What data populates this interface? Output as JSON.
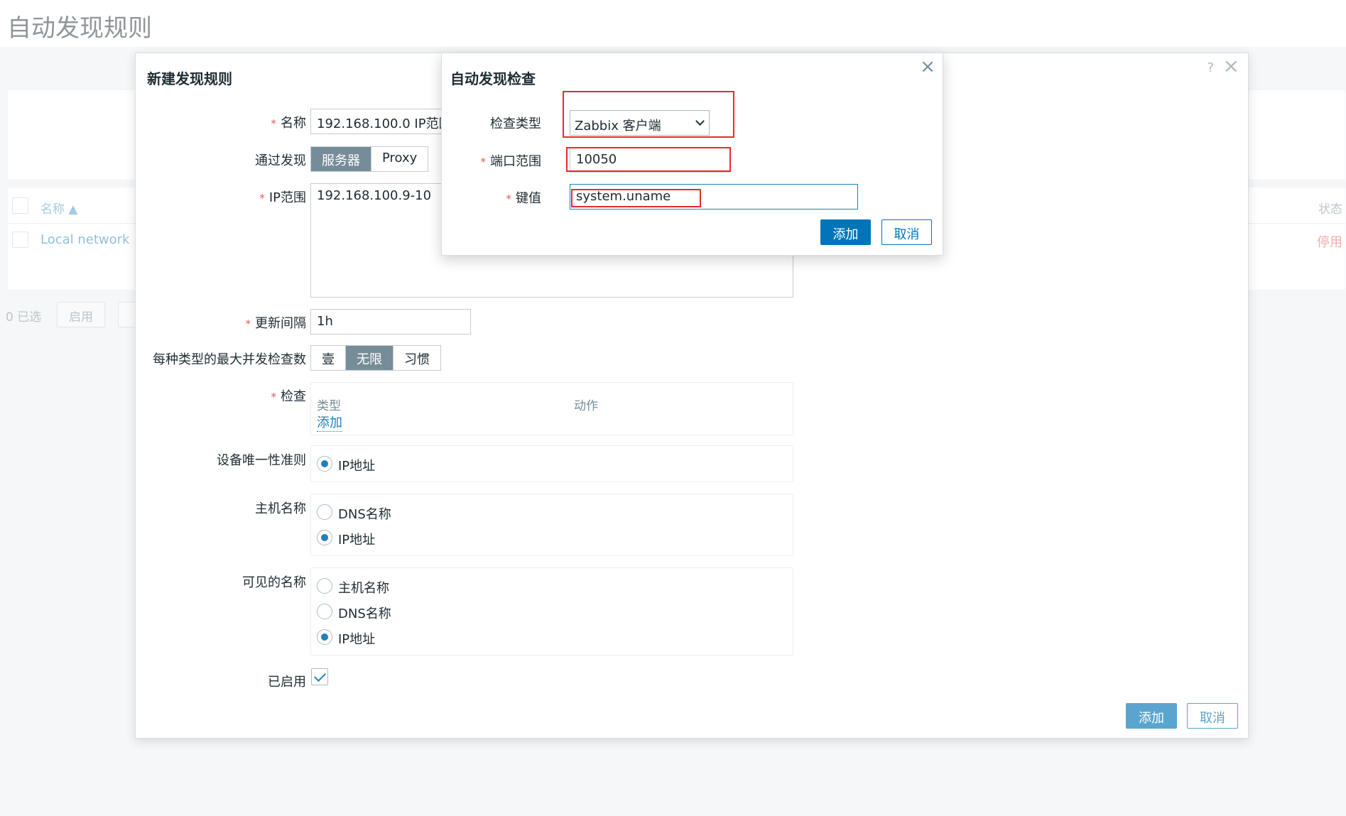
{
  "page": {
    "title": "自动发现规则",
    "table": {
      "col_name": "名称 ▲",
      "col_status": "状态",
      "row_name": "Local network",
      "row_status": "停用"
    },
    "selected_count": "0 已选",
    "enable_btn": "启用"
  },
  "dialog": {
    "title": "新建发现规则",
    "help": "?",
    "close": "×",
    "fields": {
      "name_label": "名称",
      "name_value": "192.168.100.0 IP范围",
      "discover_by_label": "通过发现",
      "discover_by_options": [
        "服务器",
        "Proxy"
      ],
      "discover_by_selected": "服务器",
      "ip_range_label": "IP范围",
      "ip_range_value": "192.168.100.9-10",
      "update_interval_label": "更新间隔",
      "update_interval_value": "1h",
      "max_checks_label": "每种类型的最大并发检查数",
      "max_checks_options": [
        "壹",
        "无限",
        "习惯"
      ],
      "max_checks_selected": "无限",
      "checks_label": "检查",
      "checks_col_type": "类型",
      "checks_col_action": "动作",
      "checks_add": "添加",
      "uniqueness_label": "设备唯一性准则",
      "uniqueness_option": "IP地址",
      "host_name_label": "主机名称",
      "host_name_options": [
        "DNS名称",
        "IP地址"
      ],
      "host_name_selected": "IP地址",
      "visible_name_label": "可见的名称",
      "visible_name_options": [
        "主机名称",
        "DNS名称",
        "IP地址"
      ],
      "visible_name_selected": "IP地址",
      "enabled_label": "已启用",
      "enabled": true
    },
    "buttons": {
      "add": "添加",
      "cancel": "取消"
    }
  },
  "subdialog": {
    "title": "自动发现检查",
    "close": "×",
    "check_type_label": "检查类型",
    "check_type_value": "Zabbix 客户端",
    "port_range_label": "端口范围",
    "port_range_value": "10050",
    "key_label": "键值",
    "key_value": "system.uname",
    "buttons": {
      "add": "添加",
      "cancel": "取消"
    }
  },
  "colors": {
    "primary": "#0275b8",
    "required": "#e45959",
    "highlight": "#e32d2d",
    "segment_active": "#768d99"
  }
}
